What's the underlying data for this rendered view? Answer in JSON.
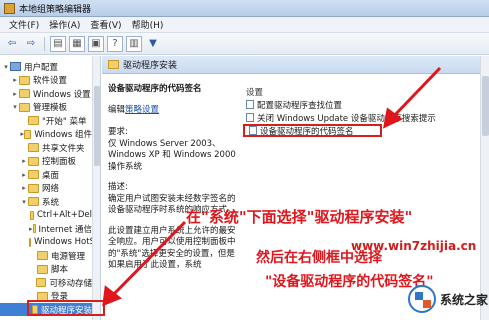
{
  "window": {
    "title": "本地组策略编辑器"
  },
  "menu": [
    "文件(F)",
    "操作(A)",
    "查看(V)",
    "帮助(H)"
  ],
  "toolbar": {
    "back": "⇦",
    "forward": "⇨",
    "filter": "▼"
  },
  "tree": [
    {
      "label": "用户配置",
      "indent": 0,
      "expander": "▾",
      "icon": "pc",
      "selected": false
    },
    {
      "label": "软件设置",
      "indent": 1,
      "expander": "▸",
      "icon": "folder",
      "selected": false
    },
    {
      "label": "Windows 设置",
      "indent": 1,
      "expander": "▸",
      "icon": "folder",
      "selected": false
    },
    {
      "label": "管理模板",
      "indent": 1,
      "expander": "▾",
      "icon": "folder",
      "selected": false
    },
    {
      "label": "\"开始\" 菜单",
      "indent": 2,
      "expander": "",
      "icon": "folder",
      "selected": false
    },
    {
      "label": "Windows 组件",
      "indent": 2,
      "expander": "▸",
      "icon": "folder",
      "selected": false
    },
    {
      "label": "共享文件夹",
      "indent": 2,
      "expander": "",
      "icon": "folder",
      "selected": false
    },
    {
      "label": "控制面板",
      "indent": 2,
      "expander": "▸",
      "icon": "folder",
      "selected": false
    },
    {
      "label": "桌面",
      "indent": 2,
      "expander": "▸",
      "icon": "folder",
      "selected": false
    },
    {
      "label": "网络",
      "indent": 2,
      "expander": "▸",
      "icon": "folder",
      "selected": false
    },
    {
      "label": "系统",
      "indent": 2,
      "expander": "▾",
      "icon": "folder",
      "selected": false
    },
    {
      "label": "Ctrl+Alt+Del",
      "indent": 3,
      "expander": "",
      "icon": "folder",
      "selected": false
    },
    {
      "label": "Internet 通信",
      "indent": 3,
      "expander": "▸",
      "icon": "folder",
      "selected": false
    },
    {
      "label": "Windows HotStart",
      "indent": 3,
      "expander": "",
      "icon": "folder",
      "selected": false
    },
    {
      "label": "电源管理",
      "indent": 3,
      "expander": "",
      "icon": "folder",
      "selected": false
    },
    {
      "label": "脚本",
      "indent": 3,
      "expander": "",
      "icon": "folder",
      "selected": false
    },
    {
      "label": "可移动存储",
      "indent": 3,
      "expander": "",
      "icon": "folder",
      "selected": false
    },
    {
      "label": "登录",
      "indent": 3,
      "expander": "",
      "icon": "folder",
      "selected": false
    },
    {
      "label": "驱动程序安装",
      "indent": 3,
      "expander": "",
      "icon": "folder",
      "selected": true
    }
  ],
  "main": {
    "header": "驱动程序安装",
    "policy_title": "设备驱动程序的代码签名",
    "edit_prefix": "编辑",
    "edit_link": "策略设置",
    "requirements_label": "要求:",
    "requirements_text": "仅 Windows Server 2003、Windows XP 和 Windows 2000 操作系统",
    "description_label": "描述:",
    "description_text": "确定用户试图安装未经数字签名的设备驱动程序时系统的响应方式。",
    "description_more": "此设置建立用户系统上允许的最安全响应。用户可以使用控制面板中的\"系统\"选择更安全的设置，但是如果启用了此设置，系统",
    "column_header": "设置",
    "settings": [
      {
        "label": "配置驱动程序查找位置",
        "highlighted": false
      },
      {
        "label": "关闭 Windows Update 设备驱动程序搜索提示",
        "highlighted": false
      },
      {
        "label": "设备驱动程序的代码签名",
        "highlighted": true
      }
    ]
  },
  "annotations": {
    "line1": "在\"系统\"下面选择\"驱动程序安装\"",
    "line2": "然后在右侧框中选择",
    "line3": "\"设备驱动程序的代码签名\""
  },
  "watermark": {
    "site": "www.win7zhijia.cn",
    "logo_text": "系统之家"
  },
  "colors": {
    "annotation": "#e0161c",
    "selection": "#3f80d6",
    "header_band": "#c9dbf1"
  }
}
